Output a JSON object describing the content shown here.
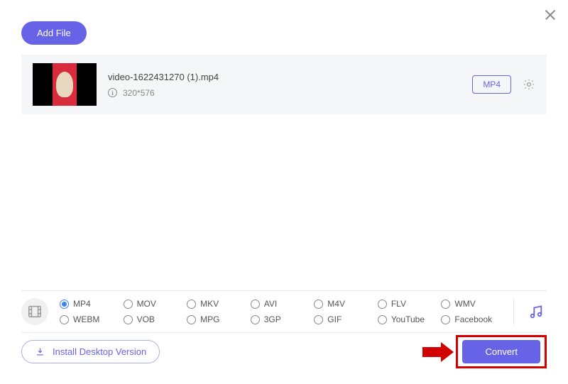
{
  "topbar": {
    "add_file_label": "Add File"
  },
  "file": {
    "name": "video-1622431270 (1).mp4",
    "resolution": "320*576",
    "format_button": "MP4"
  },
  "formats": {
    "selected_index": 0,
    "options": [
      "MP4",
      "MOV",
      "MKV",
      "AVI",
      "M4V",
      "FLV",
      "WMV",
      "WEBM",
      "VOB",
      "MPG",
      "3GP",
      "GIF",
      "YouTube",
      "Facebook"
    ]
  },
  "footer": {
    "install_label": "Install Desktop Version",
    "convert_label": "Convert"
  }
}
